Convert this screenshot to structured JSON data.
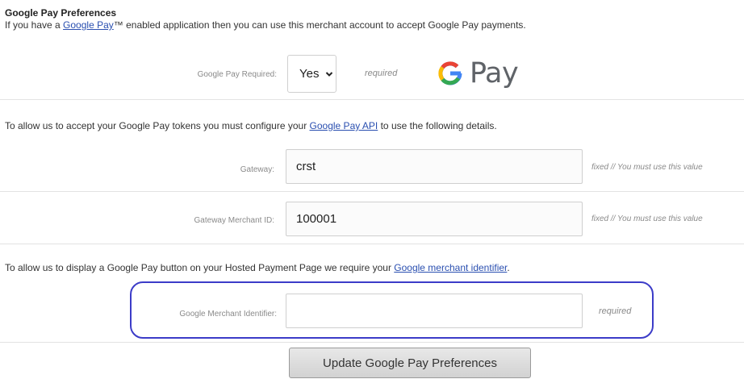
{
  "section": {
    "title": "Google Pay Preferences",
    "intro_prefix": "If you have a ",
    "intro_link": "Google Pay",
    "intro_suffix": "™ enabled application then you can use this merchant account to accept Google Pay payments."
  },
  "required_row": {
    "label": "Google Pay Required:",
    "selected": "Yes",
    "note": "required"
  },
  "logo": {
    "text": "Pay",
    "icon": "google-g-icon"
  },
  "tokens_info": {
    "prefix": "To allow us to accept your Google Pay tokens you must configure your ",
    "link": "Google Pay API",
    "suffix": " to use the following details."
  },
  "gateway": {
    "label": "Gateway:",
    "value": "crst",
    "note": "fixed // You must use this value"
  },
  "merchant_id": {
    "label": "Gateway Merchant ID:",
    "value": "100001",
    "note": "fixed // You must use this value"
  },
  "button_info": {
    "prefix": "To allow us to display a Google Pay button on your Hosted Payment Page we require your ",
    "link": "Google merchant identifier",
    "suffix": "."
  },
  "merchant_identifier": {
    "label": "Google Merchant Identifier:",
    "value": "",
    "note": "required"
  },
  "submit": {
    "label": "Update Google Pay Preferences"
  },
  "colors": {
    "link": "#2a4fb0",
    "highlight": "#3c3cc8"
  }
}
